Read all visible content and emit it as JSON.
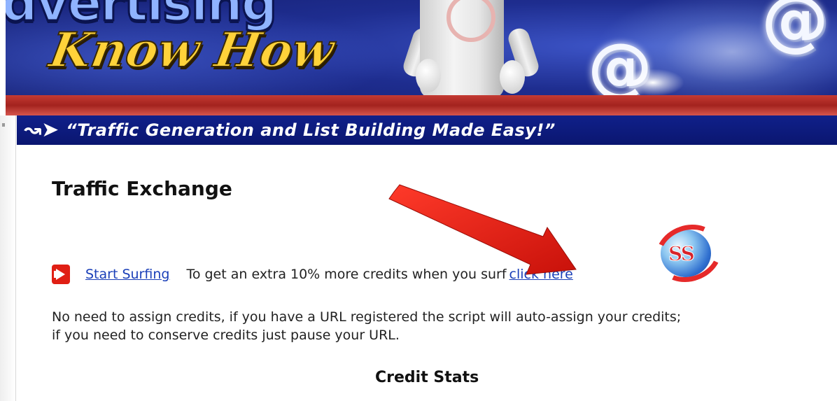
{
  "banner": {
    "top_word": "dvertising",
    "script_text": "Know How",
    "at_glyph": "@"
  },
  "tagline": {
    "icon": "↝➤",
    "text": "“Traffic Generation and List Building Made Easy!”"
  },
  "page": {
    "heading": "Traffic Exchange",
    "start_surfing_label": "Start Surfing",
    "extra_credits_text": "To get an extra 10% more credits when you surf",
    "click_here_label": "click here",
    "globe_text": "SS",
    "paragraph_line1": "No need to assign credits, if you have a URL registered the script will auto-assign your credits;",
    "paragraph_line2": "if you need to conserve credits just pause your URL.",
    "credit_stats_title": "Credit Stats"
  },
  "colors": {
    "banner_blue": "#1e2d8f",
    "tagline_blue": "#10208a",
    "accent_red": "#e01f14",
    "link_blue": "#1a3fb8",
    "arrow_red": "#e8170e"
  }
}
